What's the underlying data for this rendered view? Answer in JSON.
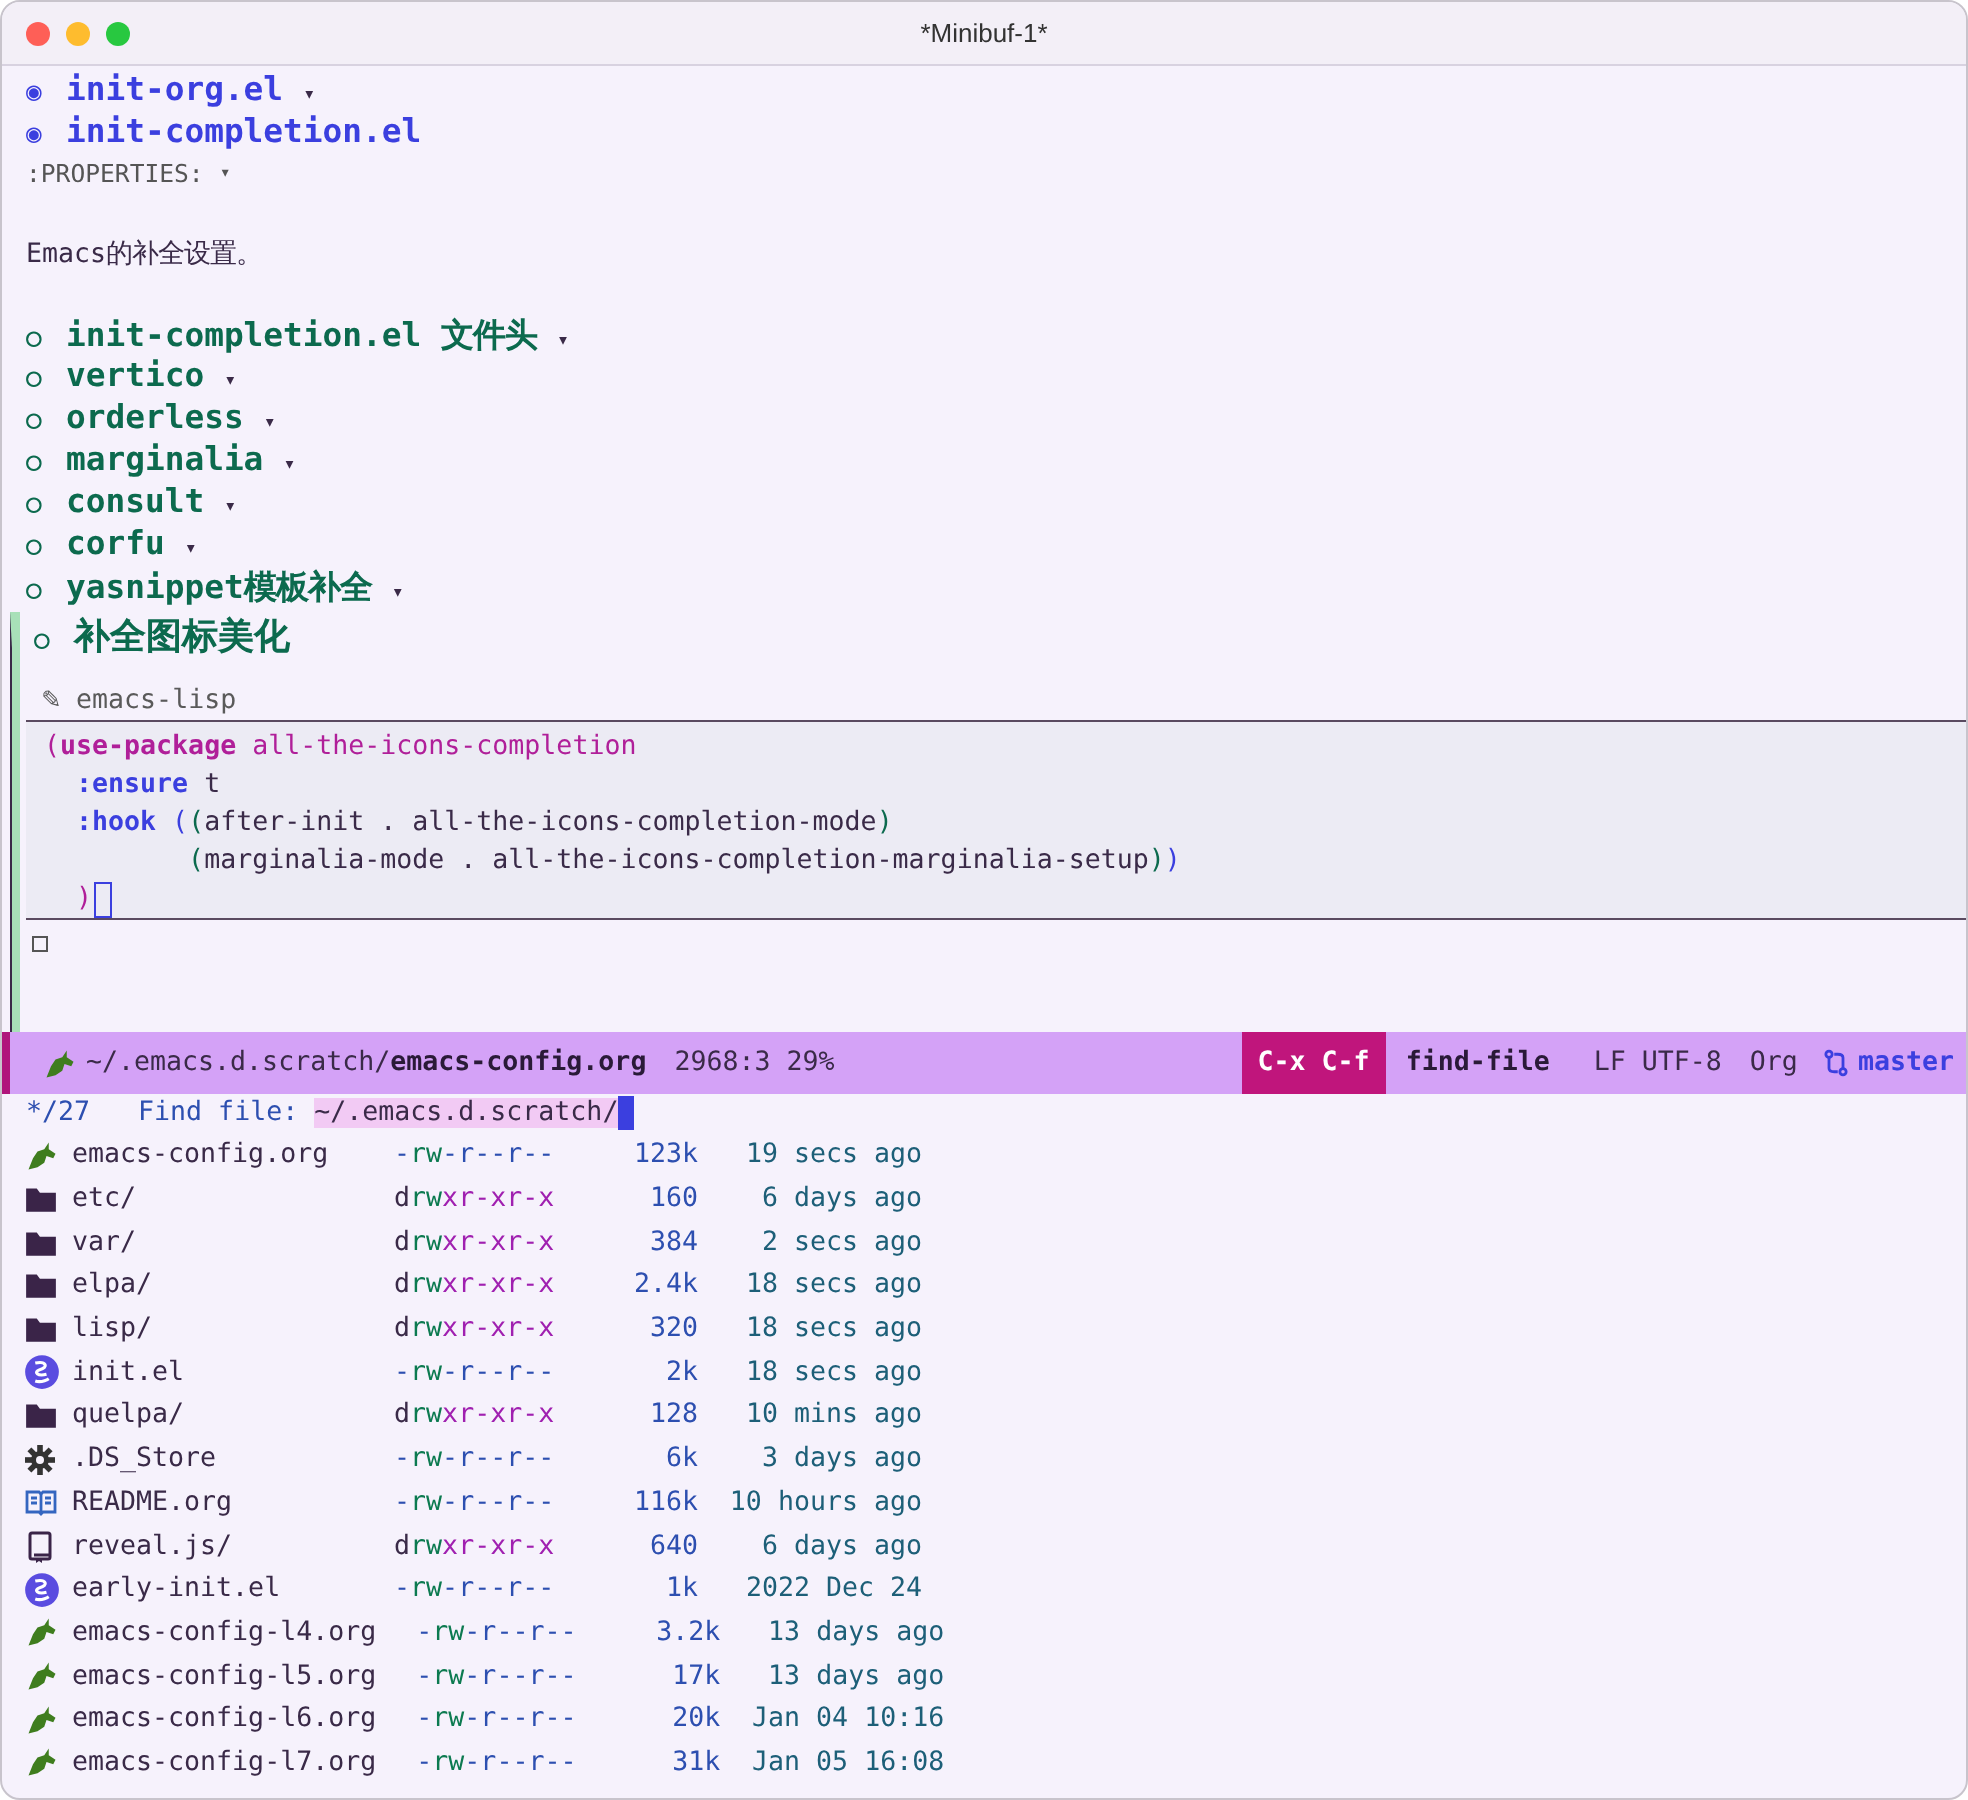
{
  "window": {
    "title": "*Minibuf-1*"
  },
  "top_headings": [
    {
      "kind": "level1",
      "bullet": "◉",
      "title": "init-org.el",
      "fold": "▾"
    },
    {
      "kind": "level1",
      "bullet": "◉",
      "title": "init-completion.el"
    }
  ],
  "properties": {
    "text": ":PROPERTIES:",
    "fold": "▾"
  },
  "paragraph": "Emacs的补全设置。",
  "headings": [
    {
      "kind": "level2",
      "bullet": "○",
      "title": "init-completion.el 文件头",
      "fold": "▾"
    },
    {
      "kind": "level2",
      "bullet": "○",
      "title": "vertico",
      "fold": "▾"
    },
    {
      "kind": "level2",
      "bullet": "○",
      "title": "orderless",
      "fold": "▾"
    },
    {
      "kind": "level2",
      "bullet": "○",
      "title": "marginalia",
      "fold": "▾"
    },
    {
      "kind": "level2",
      "bullet": "○",
      "title": "consult",
      "fold": "▾"
    },
    {
      "kind": "level2",
      "bullet": "○",
      "title": "corfu",
      "fold": "▾"
    },
    {
      "kind": "level2",
      "bullet": "○",
      "title": "yasnippet模板补全",
      "fold": "▾"
    }
  ],
  "current_heading": {
    "kind": "level2",
    "bullet": "○",
    "title": "补全图标美化"
  },
  "src_block": {
    "marker": "✎",
    "language": "emacs-lisp",
    "cursor": true,
    "lines": [
      [
        {
          "kind": "paren-outer",
          "text": "("
        },
        {
          "kind": "macro",
          "text": "use-package"
        },
        {
          "kind": "name",
          "text": " all-the-icons-completion"
        }
      ],
      [
        {
          "kind": "keyword",
          "text": "  :ensure"
        },
        {
          "kind": "plain",
          "text": " t"
        }
      ],
      [
        {
          "kind": "keyword",
          "text": "  :hook"
        },
        {
          "kind": "paren-blue",
          "text": " ("
        },
        {
          "kind": "paren-green",
          "text": "("
        },
        {
          "kind": "plain",
          "text": "after-init . all-the-icons-completion-mode"
        },
        {
          "kind": "paren-green",
          "text": ")"
        }
      ],
      [
        {
          "kind": "paren-green",
          "text": "         ("
        },
        {
          "kind": "plain",
          "text": "marginalia-mode . all-the-icons-completion-marginalia-setup"
        },
        {
          "kind": "paren-green",
          "text": ")"
        },
        {
          "kind": "paren-blue",
          "text": ")"
        }
      ],
      [
        {
          "kind": "paren-outer",
          "text": "  )"
        }
      ]
    ]
  },
  "mode_line": {
    "dir": "~/.emacs.d.scratch/",
    "file": "emacs-config.org",
    "position": "2968:3 29%",
    "keys": "C-x C-f",
    "command": "find-file",
    "encoding": "LF UTF-8",
    "mode": "Org",
    "branch": "master"
  },
  "minibuffer": {
    "count": "*/27",
    "prompt": "Find file:",
    "input": "~/.emacs.d.scratch/"
  },
  "files": [
    {
      "kind": "org",
      "name": "emacs-config.org",
      "perms": "-rw-r--r--",
      "size": "123k",
      "time": "19 secs ago"
    },
    {
      "kind": "folder",
      "name": "etc/",
      "perms": "drwxr-xr-x",
      "size": "160",
      "time": "6 days ago"
    },
    {
      "kind": "folder",
      "name": "var/",
      "perms": "drwxr-xr-x",
      "size": "384",
      "time": "2 secs ago"
    },
    {
      "kind": "folder",
      "name": "elpa/",
      "perms": "drwxr-xr-x",
      "size": "2.4k",
      "time": "18 secs ago"
    },
    {
      "kind": "folder",
      "name": "lisp/",
      "perms": "drwxr-xr-x",
      "size": "320",
      "time": "18 secs ago"
    },
    {
      "kind": "elisp",
      "name": "init.el",
      "perms": "-rw-r--r--",
      "size": "2k",
      "time": "18 secs ago"
    },
    {
      "kind": "folder",
      "name": "quelpa/",
      "perms": "drwxr-xr-x",
      "size": "128",
      "time": "10 mins ago"
    },
    {
      "kind": "settings",
      "name": ".DS_Store",
      "perms": "-rw-r--r--",
      "size": "6k",
      "time": "3 days ago"
    },
    {
      "kind": "readme",
      "name": "README.org",
      "perms": "-rw-r--r--",
      "size": "116k",
      "time": "10 hours ago"
    },
    {
      "kind": "book",
      "name": "reveal.js/",
      "perms": "drwxr-xr-x",
      "size": "640",
      "time": "6 days ago"
    },
    {
      "kind": "elisp",
      "name": "early-init.el",
      "perms": "-rw-r--r--",
      "size": "1k",
      "time": "2022 Dec 24"
    },
    {
      "kind": "org",
      "name": "emacs-config-l4.org",
      "perms": "-rw-r--r--",
      "size": "3.2k",
      "time": "13 days ago"
    },
    {
      "kind": "org",
      "name": "emacs-config-l5.org",
      "perms": "-rw-r--r--",
      "size": "17k",
      "time": "13 days ago"
    },
    {
      "kind": "org",
      "name": "emacs-config-l6.org",
      "perms": "-rw-r--r--",
      "size": "20k",
      "time": "Jan 04 10:16"
    },
    {
      "kind": "org",
      "name": "emacs-config-l7.org",
      "perms": "-rw-r--r--",
      "size": "31k",
      "time": "Jan 05 16:08"
    }
  ]
}
